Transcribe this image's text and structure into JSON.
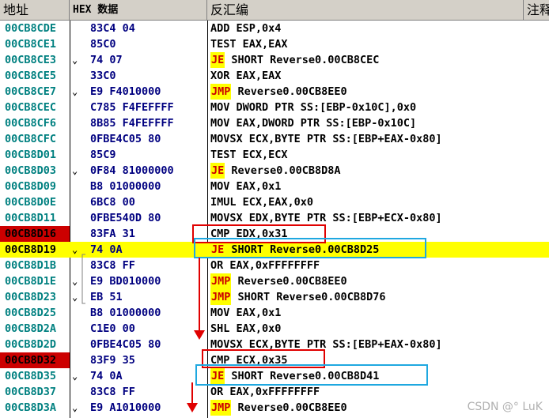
{
  "columns": {
    "address": "地址",
    "hex": "HEX 数据",
    "disasm": "反汇编",
    "comment": "注释"
  },
  "rows": [
    {
      "addr": "00CB8CDE",
      "hex": "83C4 04",
      "mnem": "",
      "asm": "ADD ESP,0x4",
      "jmark": "",
      "hl": false,
      "mark": false
    },
    {
      "addr": "00CB8CE1",
      "hex": "85C0",
      "mnem": "",
      "asm": "TEST EAX,EAX",
      "jmark": "",
      "hl": false,
      "mark": false
    },
    {
      "addr": "00CB8CE3",
      "hex": "74 07",
      "mnem": "JE",
      "asm": " SHORT Reverse0.00CB8CEC",
      "jmark": "⌄",
      "hl": false,
      "mark": false
    },
    {
      "addr": "00CB8CE5",
      "hex": "33C0",
      "mnem": "",
      "asm": "XOR EAX,EAX",
      "jmark": "",
      "hl": false,
      "mark": false
    },
    {
      "addr": "00CB8CE7",
      "hex": "E9 F4010000",
      "mnem": "JMP",
      "asm": " Reverse0.00CB8EE0",
      "jmark": "⌄",
      "hl": false,
      "mark": false
    },
    {
      "addr": "00CB8CEC",
      "hex": "C785 F4FEFFFF",
      "mnem": "",
      "asm": "MOV DWORD PTR SS:[EBP-0x10C],0x0",
      "jmark": "",
      "hl": false,
      "mark": false
    },
    {
      "addr": "00CB8CF6",
      "hex": "8B85 F4FEFFFF",
      "mnem": "",
      "asm": "MOV EAX,DWORD PTR SS:[EBP-0x10C]",
      "jmark": "",
      "hl": false,
      "mark": false
    },
    {
      "addr": "00CB8CFC",
      "hex": "0FBE4C05 80",
      "mnem": "",
      "asm": "MOVSX ECX,BYTE PTR SS:[EBP+EAX-0x80]",
      "jmark": "",
      "hl": false,
      "mark": false
    },
    {
      "addr": "00CB8D01",
      "hex": "85C9",
      "mnem": "",
      "asm": "TEST ECX,ECX",
      "jmark": "",
      "hl": false,
      "mark": false
    },
    {
      "addr": "00CB8D03",
      "hex": "0F84 81000000",
      "mnem": "JE",
      "asm": " Reverse0.00CB8D8A",
      "jmark": "⌄",
      "hl": false,
      "mark": false
    },
    {
      "addr": "00CB8D09",
      "hex": "B8 01000000",
      "mnem": "",
      "asm": "MOV EAX,0x1",
      "jmark": "",
      "hl": false,
      "mark": false
    },
    {
      "addr": "00CB8D0E",
      "hex": "6BC8 00",
      "mnem": "",
      "asm": "IMUL ECX,EAX,0x0",
      "jmark": "",
      "hl": false,
      "mark": false
    },
    {
      "addr": "00CB8D11",
      "hex": "0FBE540D 80",
      "mnem": "",
      "asm": "MOVSX EDX,BYTE PTR SS:[EBP+ECX-0x80]",
      "jmark": "",
      "hl": false,
      "mark": false
    },
    {
      "addr": "00CB8D16",
      "hex": "83FA 31",
      "mnem": "",
      "asm": "CMP EDX,0x31",
      "jmark": "",
      "hl": false,
      "mark": true
    },
    {
      "addr": "00CB8D19",
      "hex": "74 0A",
      "mnem": "JE",
      "asm": " SHORT Reverse0.00CB8D25",
      "jmark": "⌄",
      "hl": true,
      "mark": true
    },
    {
      "addr": "00CB8D1B",
      "hex": "83C8 FF",
      "mnem": "",
      "asm": "OR EAX,0xFFFFFFFF",
      "jmark": "",
      "hl": false,
      "mark": false
    },
    {
      "addr": "00CB8D1E",
      "hex": "E9 BD010000",
      "mnem": "JMP",
      "asm": " Reverse0.00CB8EE0",
      "jmark": "⌄",
      "hl": false,
      "mark": false
    },
    {
      "addr": "00CB8D23",
      "hex": "EB 51",
      "mnem": "JMP",
      "asm": " SHORT Reverse0.00CB8D76",
      "jmark": "⌄",
      "hl": false,
      "mark": false
    },
    {
      "addr": "00CB8D25",
      "hex": "B8 01000000",
      "mnem": "",
      "asm": "MOV EAX,0x1",
      "jmark": "",
      "hl": false,
      "mark": false
    },
    {
      "addr": "00CB8D2A",
      "hex": "C1E0 00",
      "mnem": "",
      "asm": "SHL EAX,0x0",
      "jmark": "",
      "hl": false,
      "mark": false
    },
    {
      "addr": "00CB8D2D",
      "hex": "0FBE4C05 80",
      "mnem": "",
      "asm": "MOVSX ECX,BYTE PTR SS:[EBP+EAX-0x80]",
      "jmark": "",
      "hl": false,
      "mark": false
    },
    {
      "addr": "00CB8D32",
      "hex": "83F9 35",
      "mnem": "",
      "asm": "CMP ECX,0x35",
      "jmark": "",
      "hl": false,
      "mark": true
    },
    {
      "addr": "00CB8D35",
      "hex": "74 0A",
      "mnem": "JE",
      "asm": " SHORT Reverse0.00CB8D41",
      "jmark": "⌄",
      "hl": false,
      "mark": false
    },
    {
      "addr": "00CB8D37",
      "hex": "83C8 FF",
      "mnem": "",
      "asm": "OR EAX,0xFFFFFFFF",
      "jmark": "",
      "hl": false,
      "mark": false
    },
    {
      "addr": "00CB8D3A",
      "hex": "E9 A1010000",
      "mnem": "JMP",
      "asm": " Reverse0.00CB8EE0",
      "jmark": "⌄",
      "hl": false,
      "mark": false
    }
  ],
  "watermark": "CSDN @° LuK",
  "colors": {
    "annotation_red": "#e00000",
    "annotation_cyan": "#1fa8e0",
    "highlight": "#ffff00",
    "address": "#008080"
  }
}
